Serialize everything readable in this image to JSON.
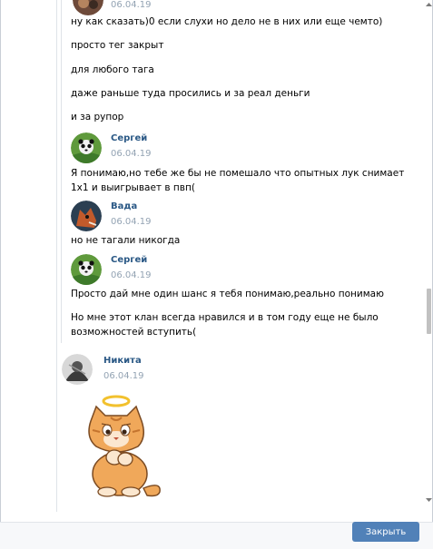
{
  "top_partial": {
    "date": "06.04.19"
  },
  "messages_block1": [
    "ну как сказать)0 если слухи но дело не в них или еще чемто)",
    "просто тег закрыт",
    "для любого тага",
    "даже раньше туда просились и за реал деньги",
    "и за рупор"
  ],
  "post_sergey_1": {
    "author": "Сергей",
    "date": "06.04.19",
    "lines": [
      "Я понимаю,но тебе же бы не помешало что опытных лук снимает",
      "1x1 и выигрывает в пвп("
    ]
  },
  "post_vada": {
    "author": "Вада",
    "date": "06.04.19",
    "lines": [
      "но не тагали никогда"
    ]
  },
  "post_sergey_2": {
    "author": "Сергей",
    "date": "06.04.19",
    "lines": [
      "Просто дай мне один шанс я тебя понимаю,реально понимаю",
      "Но мне этот клан всегда нравился и в том году еще не было",
      "возможностей вступить("
    ]
  },
  "post_nikita": {
    "author": "Никита",
    "date": "06.04.19",
    "sticker": "angel-cat-sticker"
  },
  "footer": {
    "close_label": "Закрыть"
  },
  "colors": {
    "link": "#2a5885",
    "date": "#93a3b3",
    "button": "#5181b8"
  }
}
